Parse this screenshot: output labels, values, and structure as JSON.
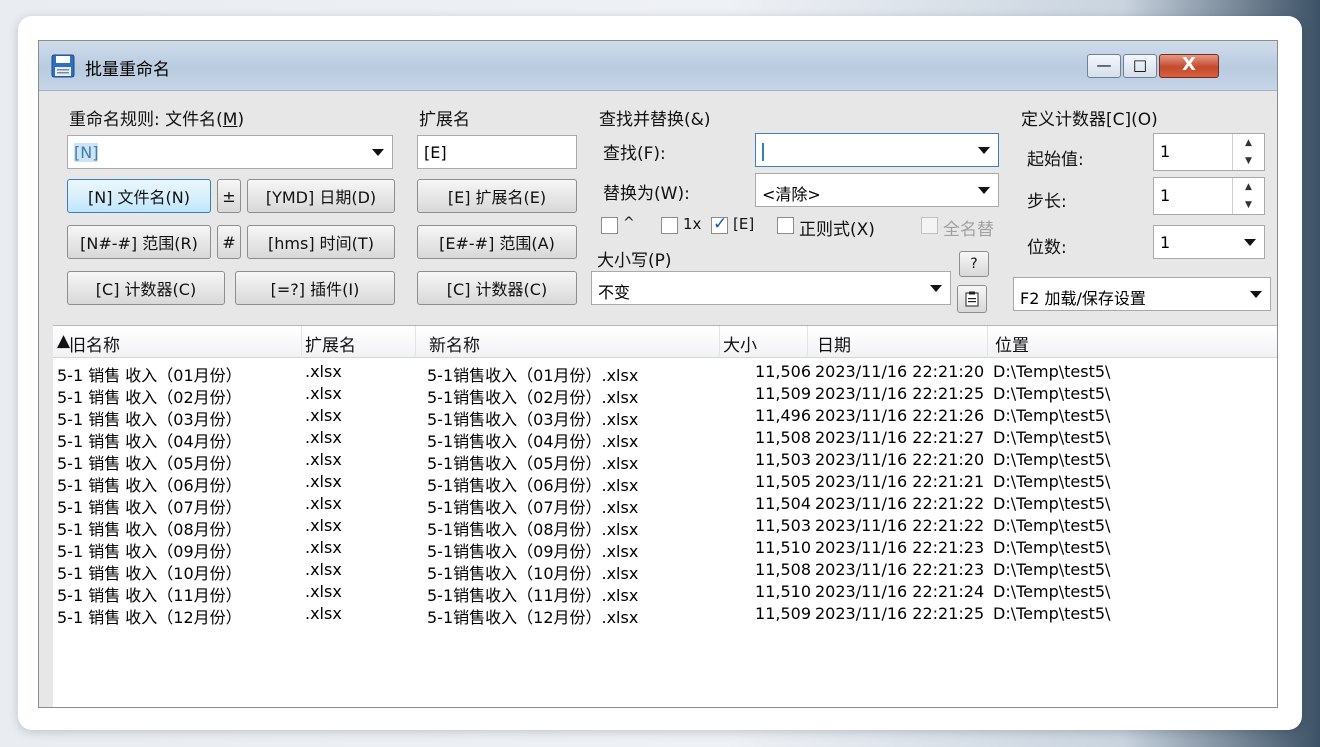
{
  "window": {
    "title": "批量重命名",
    "buttons": {
      "minimize": "—",
      "maximize": "□",
      "close": "X"
    }
  },
  "rename_rule": {
    "label": "重命名规则: 文件名(",
    "label_key": "M",
    "label_tail": ")",
    "value": "[N]",
    "buttons": {
      "n_filename": "[N] 文件名(N)",
      "plusminus": "±",
      "ymd_date": "[YMD] 日期(D)",
      "n_range": "[N#-#] 范围(R)",
      "hash": "#",
      "hms_time": "[hms] 时间(T)",
      "counter": "[C] 计数器(C)",
      "plugin": "[=?] 插件(I)"
    }
  },
  "extension": {
    "label": "扩展名",
    "value": "[E]",
    "buttons": {
      "ext": "[E] 扩展名(E)",
      "range": "[E#-#] 范围(A)",
      "counter": "[C] 计数器(C)"
    }
  },
  "find_replace": {
    "label": "查找并替换(&)",
    "find_label": "查找(F):",
    "find_value": "",
    "replace_label": "替换为(W):",
    "replace_value": "<清除>",
    "options": {
      "caret": "^",
      "once": "1x",
      "ext": "[E]",
      "regex": "正则式(X)",
      "fullname": "全名替"
    },
    "case_label": "大小写(P)",
    "case_value": "不变",
    "help_button": "?"
  },
  "counter": {
    "label": "定义计数器[C](O)",
    "start_label": "起始值:",
    "start_value": "1",
    "step_label": "步长:",
    "step_value": "1",
    "digits_label": "位数:",
    "digits_value": "1",
    "preset_value": "F2 加载/保存设置"
  },
  "list": {
    "columns": [
      "旧名称",
      "扩展名",
      "新名称",
      "大小",
      "日期",
      "位置"
    ],
    "rows": [
      [
        "5-1  销售 收入（01月份）",
        ".xlsx",
        "5-1销售收入（01月份）.xlsx",
        "11,506",
        "2023/11/16 22:21:20",
        "D:\\Temp\\test5\\"
      ],
      [
        "5-1  销售 收入（02月份）",
        ".xlsx",
        "5-1销售收入（02月份）.xlsx",
        "11,509",
        "2023/11/16 22:21:25",
        "D:\\Temp\\test5\\"
      ],
      [
        "5-1  销售 收入（03月份）",
        ".xlsx",
        "5-1销售收入（03月份）.xlsx",
        "11,496",
        "2023/11/16 22:21:26",
        "D:\\Temp\\test5\\"
      ],
      [
        "5-1  销售 收入（04月份）",
        ".xlsx",
        "5-1销售收入（04月份）.xlsx",
        "11,508",
        "2023/11/16 22:21:27",
        "D:\\Temp\\test5\\"
      ],
      [
        "5-1  销售 收入（05月份）",
        ".xlsx",
        "5-1销售收入（05月份）.xlsx",
        "11,503",
        "2023/11/16 22:21:20",
        "D:\\Temp\\test5\\"
      ],
      [
        "5-1  销售 收入（06月份）",
        ".xlsx",
        "5-1销售收入（06月份）.xlsx",
        "11,505",
        "2023/11/16 22:21:21",
        "D:\\Temp\\test5\\"
      ],
      [
        "5-1  销售 收入（07月份）",
        ".xlsx",
        "5-1销售收入（07月份）.xlsx",
        "11,504",
        "2023/11/16 22:21:22",
        "D:\\Temp\\test5\\"
      ],
      [
        "5-1  销售 收入（08月份）",
        ".xlsx",
        "5-1销售收入（08月份）.xlsx",
        "11,503",
        "2023/11/16 22:21:22",
        "D:\\Temp\\test5\\"
      ],
      [
        "5-1  销售 收入（09月份）",
        ".xlsx",
        "5-1销售收入（09月份）.xlsx",
        "11,510",
        "2023/11/16 22:21:23",
        "D:\\Temp\\test5\\"
      ],
      [
        "5-1  销售 收入（10月份）",
        ".xlsx",
        "5-1销售收入（10月份）.xlsx",
        "11,508",
        "2023/11/16 22:21:23",
        "D:\\Temp\\test5\\"
      ],
      [
        "5-1  销售 收入（11月份）",
        ".xlsx",
        "5-1销售收入（11月份）.xlsx",
        "11,510",
        "2023/11/16 22:21:24",
        "D:\\Temp\\test5\\"
      ],
      [
        "5-1  销售 收入（12月份）",
        ".xlsx",
        "5-1销售收入（12月份）.xlsx",
        "11,509",
        "2023/11/16 22:21:25",
        "D:\\Temp\\test5\\"
      ]
    ]
  },
  "colors": {
    "title_bar": "#c6d5e7",
    "close_button": "#c44a2e",
    "focus_blue": "#3c7fb1"
  }
}
